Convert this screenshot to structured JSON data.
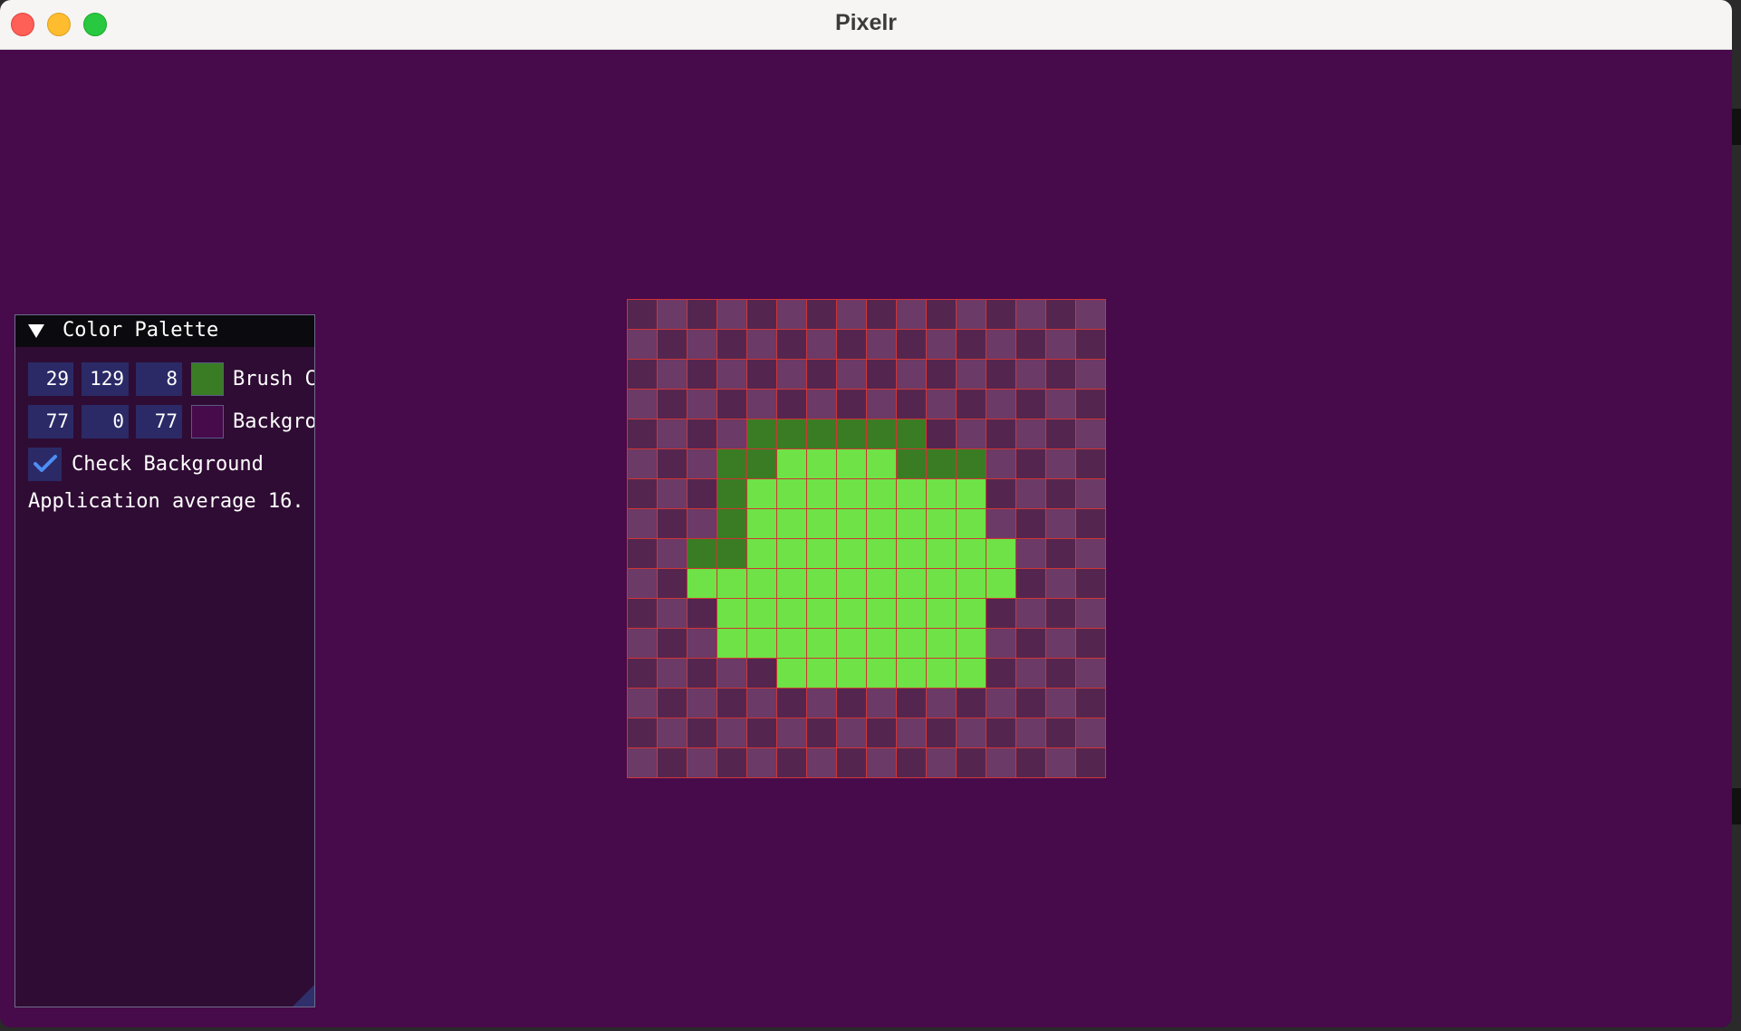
{
  "window": {
    "title": "Pixelr"
  },
  "palette": {
    "header": "Color Palette",
    "brush": {
      "r": "29",
      "g": "129",
      "b": "8",
      "label": "Brush Color",
      "swatch": "#3a7c24"
    },
    "background": {
      "r": "77",
      "g": "0",
      "b": "77",
      "label": "Background",
      "swatch": "#470a4a"
    },
    "check_background": {
      "label": "Check Background",
      "checked": true
    },
    "status_text": "Application average 16."
  },
  "colors": {
    "canvas_bg": "#470a4a",
    "checker_light": "#6b3a66",
    "checker_dark": "#54264f",
    "dark_green": "#3a7c24",
    "light_green": "#6ee246",
    "grid_line": "#d13434"
  },
  "pixel_grid": {
    "size": 16,
    "rows": [
      "................",
      "................",
      "................",
      "................",
      "....DDDDDD......",
      "...DDLLLLDDD....",
      "...DLLLLLLLL....",
      "...DLLLLLLLL....",
      "..DDLLLLLLLLL...",
      "..LLLLLLLLLLL...",
      "...LLLLLLLLL....",
      "...LLLLLLLLL....",
      ".....LLLLLLL....",
      "................",
      "................",
      "................"
    ]
  }
}
